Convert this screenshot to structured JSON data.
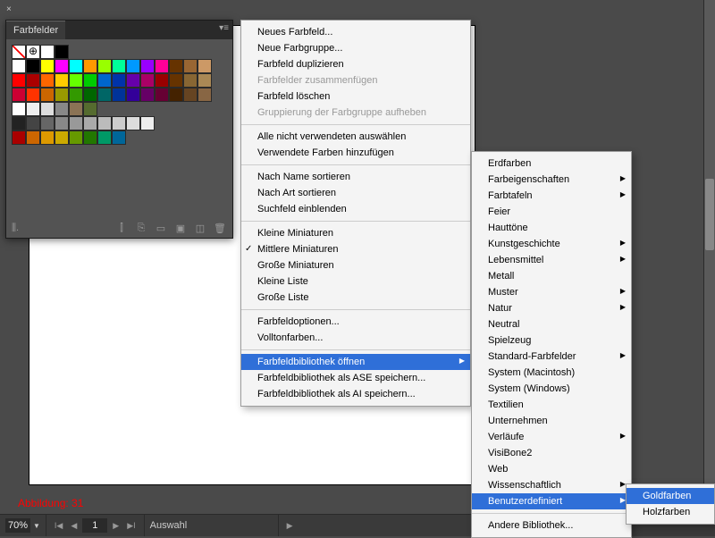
{
  "panel": {
    "title": "Farbfelder"
  },
  "status": {
    "zoom": "70%",
    "page": "1",
    "mode": "Auswahl"
  },
  "annotation": "Abbildung: 31",
  "swatch_colors": [
    [
      "#fff",
      "#000",
      "#ffff00",
      "#ff00ff",
      "#00ffff",
      "#ff9900",
      "#99ff00",
      "#00ff99",
      "#0099ff",
      "#9900ff",
      "#ff0099",
      "#663300",
      "#996633",
      "#cc9966"
    ],
    [
      "#ff0000",
      "#aa0000",
      "#ff6600",
      "#ffcc00",
      "#66ff00",
      "#00cc00",
      "#0066cc",
      "#0033aa",
      "#6600aa",
      "#aa0066",
      "#990000",
      "#663300",
      "#886633",
      "#aa8855"
    ],
    [
      "#cc0033",
      "#ff3300",
      "#cc6600",
      "#999900",
      "#339900",
      "#006600",
      "#006666",
      "#003399",
      "#330099",
      "#660066",
      "#660033",
      "#442200",
      "#664422",
      "#886644"
    ],
    [
      "#ffffff",
      "#eeeeee",
      "#dddddd",
      "#888888",
      "#8b7355",
      "#556b2f",
      "",
      "",
      "",
      "",
      "",
      "",
      "",
      ""
    ],
    [
      "#222222",
      "#444444",
      "#666666",
      "#888888",
      "#999999",
      "#aaaaaa",
      "#bbbbbb",
      "#cccccc",
      "#dddddd",
      "#eeeeee",
      "",
      "",
      "",
      ""
    ],
    [
      "#aa0000",
      "#cc6600",
      "#dd9900",
      "#ccaa00",
      "#669900",
      "#227700",
      "#009966",
      "#006699",
      "",
      "",
      "",
      "",
      "",
      ""
    ]
  ],
  "menu1_items": [
    {
      "label": "Neues Farbfeld..."
    },
    {
      "label": "Neue Farbgruppe..."
    },
    {
      "label": "Farbfeld duplizieren"
    },
    {
      "label": "Farbfelder zusammenfügen",
      "disabled": true
    },
    {
      "label": "Farbfeld löschen"
    },
    {
      "label": "Gruppierung der Farbgruppe aufheben",
      "disabled": true
    },
    {
      "sep": true
    },
    {
      "label": "Alle nicht verwendeten auswählen"
    },
    {
      "label": "Verwendete Farben hinzufügen"
    },
    {
      "sep": true
    },
    {
      "label": "Nach Name sortieren"
    },
    {
      "label": "Nach Art sortieren"
    },
    {
      "label": "Suchfeld einblenden"
    },
    {
      "sep": true
    },
    {
      "label": "Kleine Miniaturen"
    },
    {
      "label": "Mittlere Miniaturen",
      "checked": true
    },
    {
      "label": "Große Miniaturen"
    },
    {
      "label": "Kleine Liste"
    },
    {
      "label": "Große Liste"
    },
    {
      "sep": true
    },
    {
      "label": "Farbfeldoptionen..."
    },
    {
      "label": "Volltonfarben..."
    },
    {
      "sep": true
    },
    {
      "label": "Farbfeldbibliothek öffnen",
      "sel": true,
      "sub": true
    },
    {
      "label": "Farbfeldbibliothek als ASE speichern..."
    },
    {
      "label": "Farbfeldbibliothek als AI speichern..."
    }
  ],
  "menu2_items": [
    {
      "label": "Erdfarben"
    },
    {
      "label": "Farbeigenschaften",
      "sub": true
    },
    {
      "label": "Farbtafeln",
      "sub": true
    },
    {
      "label": "Feier"
    },
    {
      "label": "Hauttöne"
    },
    {
      "label": "Kunstgeschichte",
      "sub": true
    },
    {
      "label": "Lebensmittel",
      "sub": true
    },
    {
      "label": "Metall"
    },
    {
      "label": "Muster",
      "sub": true
    },
    {
      "label": "Natur",
      "sub": true
    },
    {
      "label": "Neutral"
    },
    {
      "label": "Spielzeug"
    },
    {
      "label": "Standard-Farbfelder",
      "sub": true
    },
    {
      "label": "System (Macintosh)"
    },
    {
      "label": "System (Windows)"
    },
    {
      "label": "Textilien"
    },
    {
      "label": "Unternehmen"
    },
    {
      "label": "Verläufe",
      "sub": true
    },
    {
      "label": "VisiBone2"
    },
    {
      "label": "Web"
    },
    {
      "label": "Wissenschaftlich",
      "sub": true
    },
    {
      "label": "Benutzerdefiniert",
      "sel": true,
      "sub": true
    },
    {
      "sep": true
    },
    {
      "label": "Andere Bibliothek..."
    }
  ],
  "menu3_items": [
    {
      "label": "Goldfarben",
      "sel": true
    },
    {
      "label": "Holzfarben"
    }
  ]
}
